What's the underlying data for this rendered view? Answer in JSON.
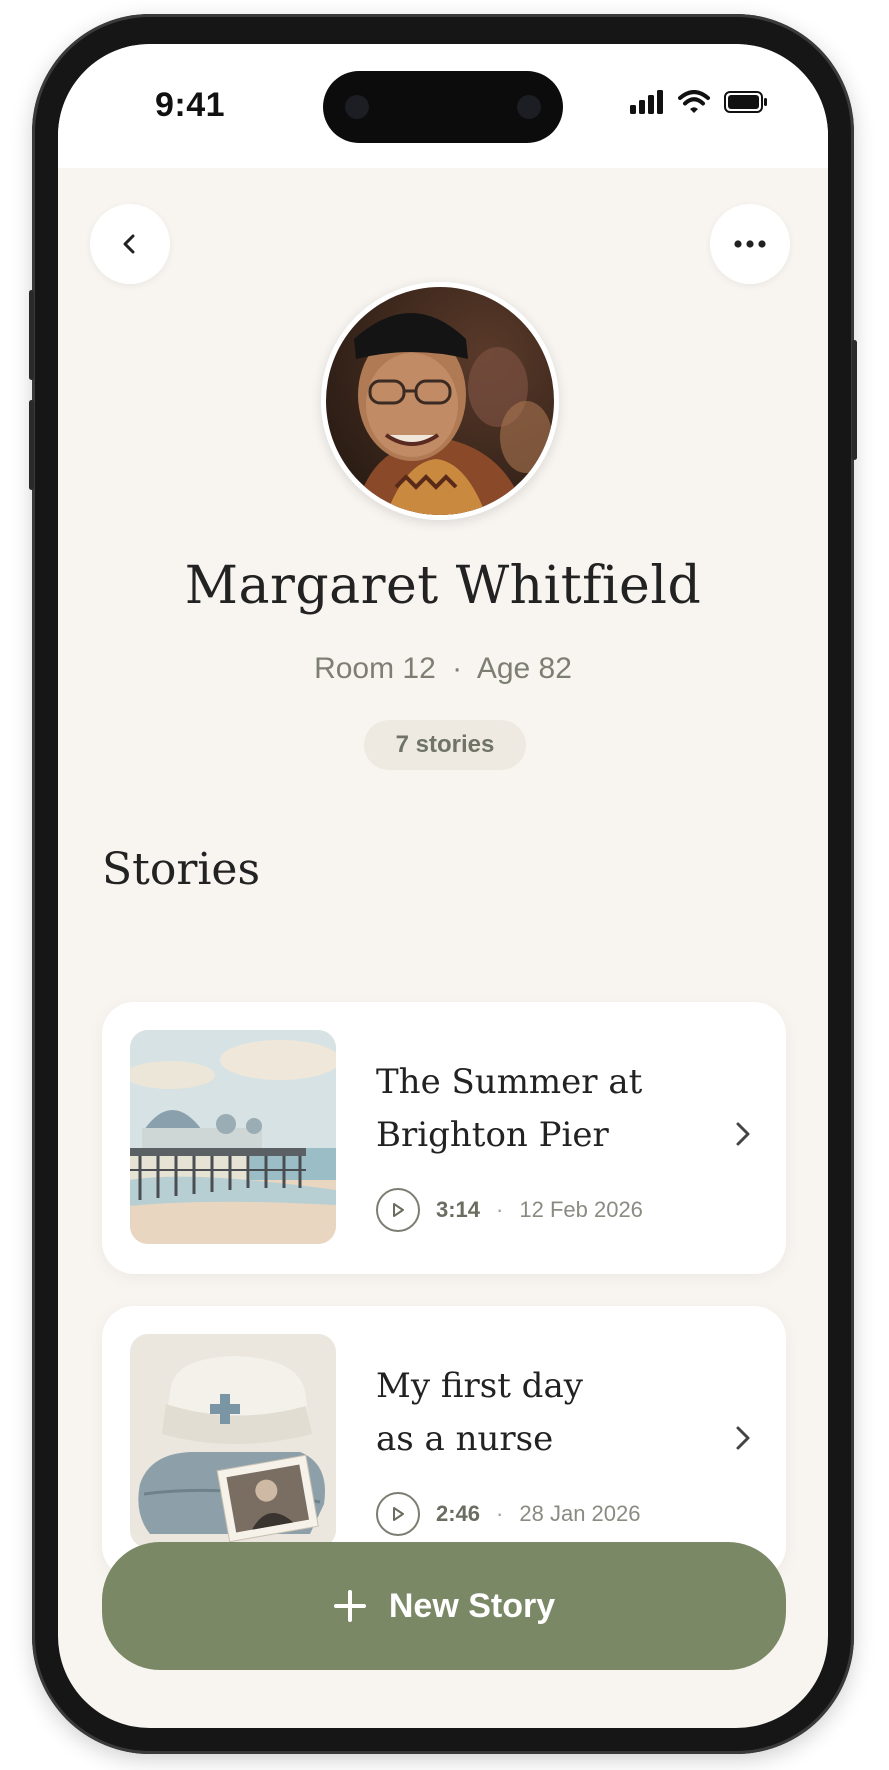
{
  "status_bar": {
    "time": "9:41"
  },
  "nav": {
    "back_icon": "chevron-left-icon",
    "more_icon": "more-horizontal-icon"
  },
  "profile": {
    "name": "Margaret Whitfield",
    "room": "Room 12",
    "age": "Age 82",
    "separator": "·",
    "story_count": "7 stories"
  },
  "stories_section": {
    "title": "Stories",
    "items": [
      {
        "title_line1": "The Summer at",
        "title_line2": "Brighton Pier",
        "duration": "3:14",
        "separator": "·",
        "date": "12 Feb 2026"
      },
      {
        "title_line1": "My first day",
        "title_line2": "as a nurse",
        "duration": "2:46",
        "separator": "·",
        "date": "28 Jan 2026"
      }
    ]
  },
  "new_story_button": {
    "label": "New Story",
    "icon": "plus-icon"
  },
  "colors": {
    "accent": "#7a8866",
    "background": "#f8f5f1",
    "pill": "#eeeae1"
  }
}
